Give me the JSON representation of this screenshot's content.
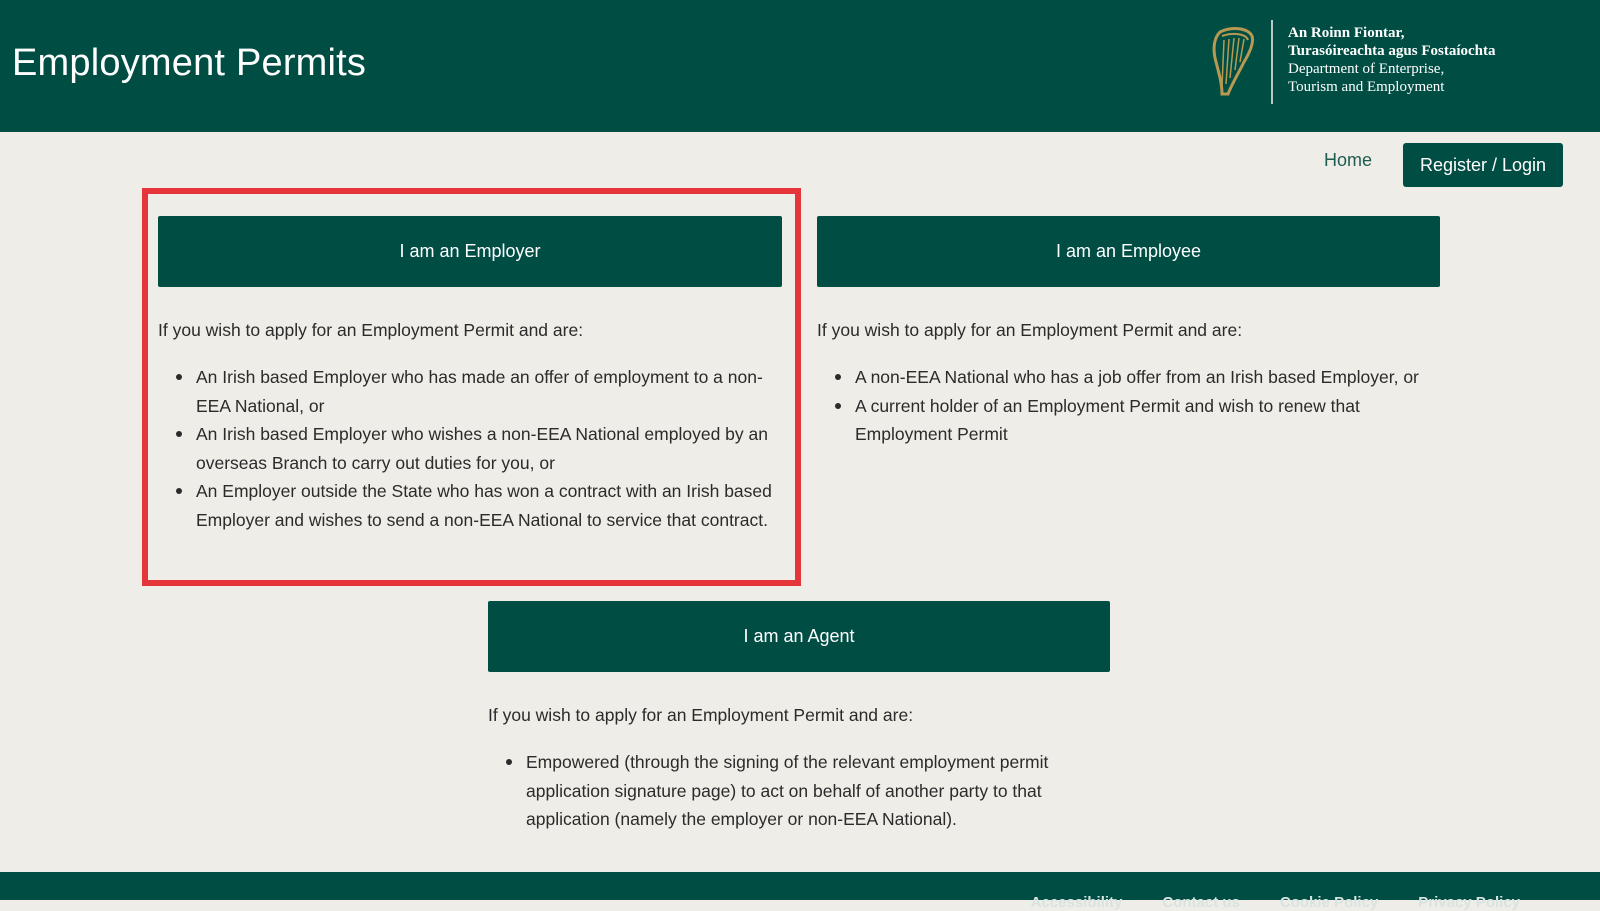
{
  "header": {
    "title": "Employment Permits",
    "logo_icon": "harp-icon",
    "department": {
      "irish_line1": "An Roinn Fiontar,",
      "irish_line2": "Turasóireachta agus Fostaíochta",
      "english_line1": "Department of Enterprise,",
      "english_line2": "Tourism and Employment"
    }
  },
  "nav": {
    "home_label": "Home",
    "login_label": "Register / Login"
  },
  "employer": {
    "button_label": "I am an Employer",
    "intro": "If you wish to apply for an Employment Permit and are:",
    "items": [
      "An Irish based Employer who has made an offer of employment to a non-EEA National, or",
      "An Irish based Employer who wishes a non-EEA National employed by an overseas Branch to carry out duties for you, or",
      "An Employer outside the State who has won a contract with an Irish based Employer and wishes to send a non-EEA National to service that contract."
    ]
  },
  "employee": {
    "button_label": "I am an Employee",
    "intro": "If you wish to apply for an Employment Permit and are:",
    "items": [
      "A non-EEA National who has a job offer from an Irish based Employer, or",
      "A current holder of an Employment Permit and wish to renew that Employment Permit"
    ]
  },
  "agent": {
    "button_label": "I am an Agent",
    "intro": "If you wish to apply for an Employment Permit and are:",
    "items": [
      "Empowered (through the signing of the relevant employment permit application signature page) to act on behalf of another party to that application (namely the employer or non-EEA National)."
    ]
  },
  "footer": {
    "links": [
      "Accessibility",
      "Contact us",
      "Cookie Policy",
      "Privacy Policy"
    ]
  },
  "colors": {
    "brand": "#004d44",
    "background": "#efede7",
    "highlight": "#e5353a"
  }
}
